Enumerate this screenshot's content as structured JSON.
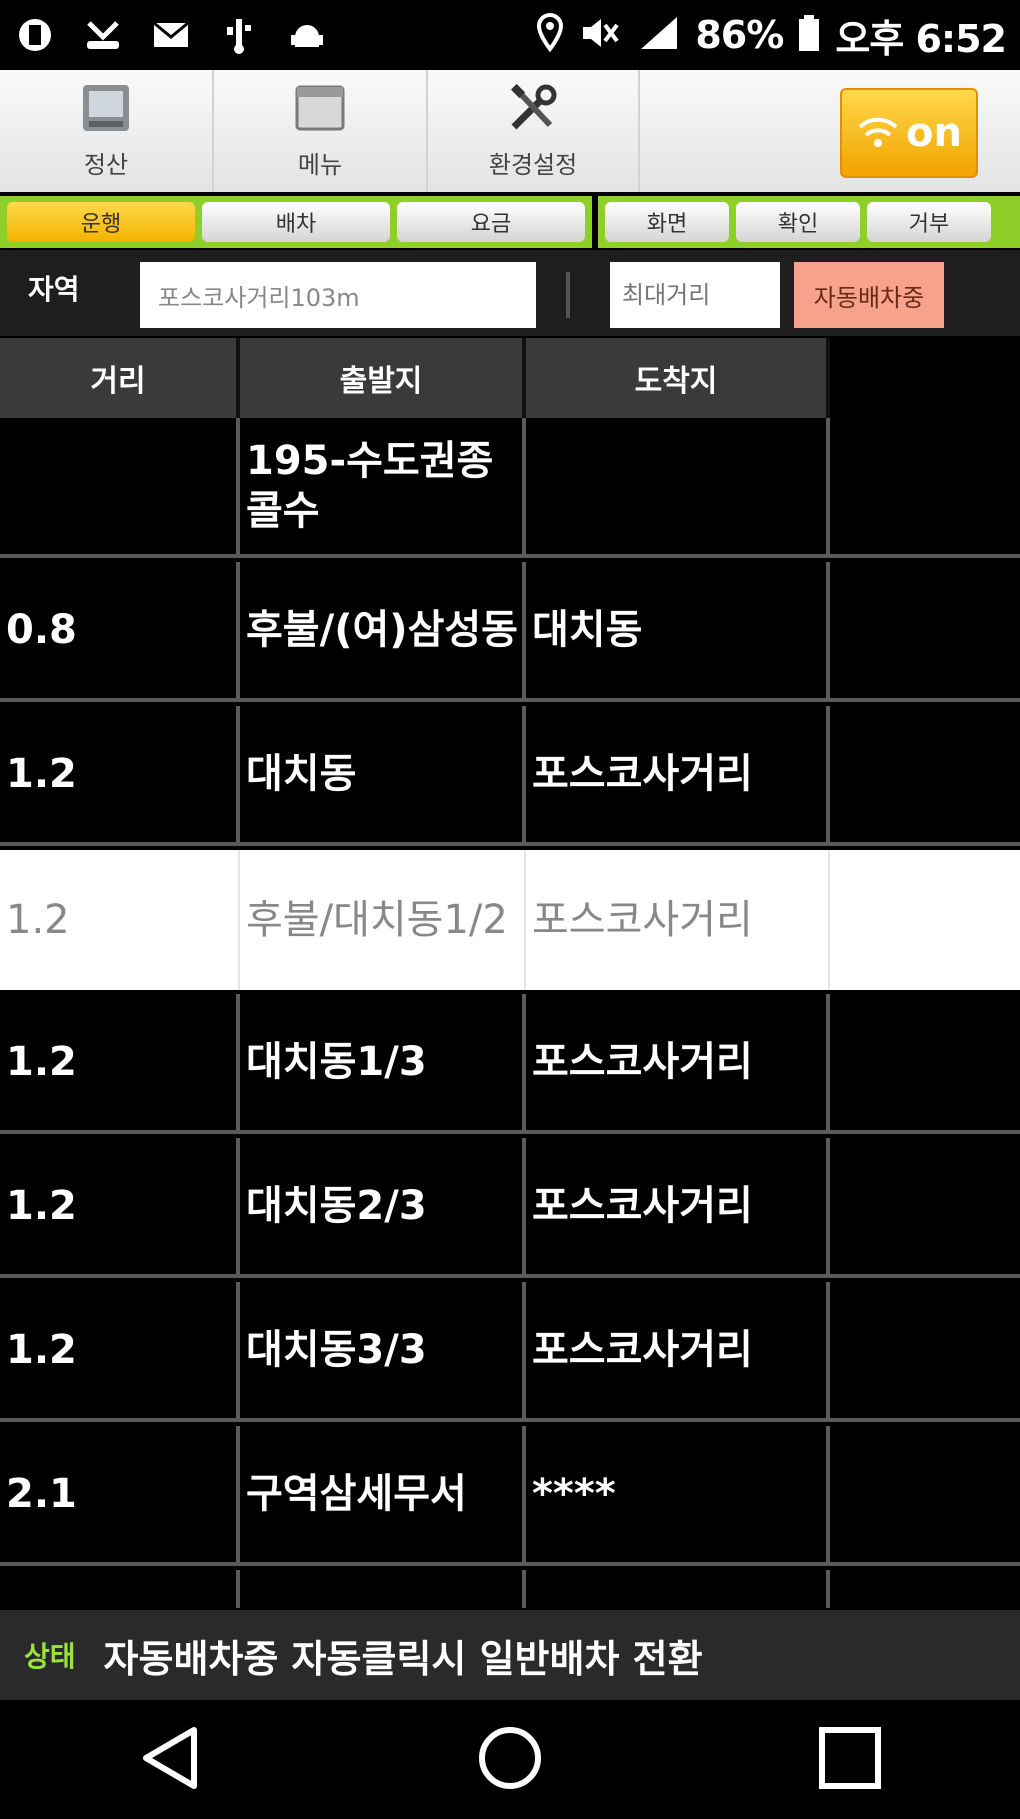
{
  "status_bar": {
    "battery": "86%",
    "time": "오후 6:52"
  },
  "toolbar": {
    "buttons": [
      {
        "label": "정산",
        "icon": "calculator-icon"
      },
      {
        "label": "메뉴",
        "icon": "menu-window-icon"
      },
      {
        "label": "환경설정",
        "icon": "tools-icon"
      }
    ],
    "on_label": "on"
  },
  "tabs": {
    "left": [
      "운행",
      "배차",
      "요금"
    ],
    "right": [
      "화면",
      "확인",
      "거부"
    ],
    "active": "운행"
  },
  "search": {
    "label": "자역",
    "location_value": "포스코사거리103m",
    "distance_placeholder": "최대거리",
    "auto_button": "자동배차중"
  },
  "table": {
    "headers": [
      "거리",
      "출발지",
      "도착지"
    ],
    "rows": [
      {
        "distance": "",
        "origin": "195-수도권종 콜수",
        "destination": "",
        "style": "dark"
      },
      {
        "distance": "0.8",
        "origin": "후불/(여)삼성동",
        "destination": "대치동",
        "style": "dark"
      },
      {
        "distance": "1.2",
        "origin": "대치동",
        "destination": "포스코사거리",
        "style": "dark"
      },
      {
        "distance": "1.2",
        "origin": "후불/대치동1/2",
        "destination": "포스코사거리",
        "style": "light"
      },
      {
        "distance": "1.2",
        "origin": "대치동1/3",
        "destination": "포스코사거리",
        "style": "dark"
      },
      {
        "distance": "1.2",
        "origin": "대치동2/3",
        "destination": "포스코사거리",
        "style": "dark"
      },
      {
        "distance": "1.2",
        "origin": "대치동3/3",
        "destination": "포스코사거리",
        "style": "dark"
      },
      {
        "distance": "2.1",
        "origin": "구역삼세무서",
        "destination": "****",
        "style": "dark"
      },
      {
        "distance": "",
        "origin": "",
        "destination": "",
        "style": "dark"
      }
    ]
  },
  "message_bar": {
    "key": "상태",
    "text": "자동배차중  자동클릭시 일반배차 전환"
  },
  "colors": {
    "tab_bar_green": "#8fcf2a",
    "on_button_orange": "#f2a300",
    "auto_button_salmon": "#f7a28a",
    "status_key_green": "#9be33a"
  }
}
